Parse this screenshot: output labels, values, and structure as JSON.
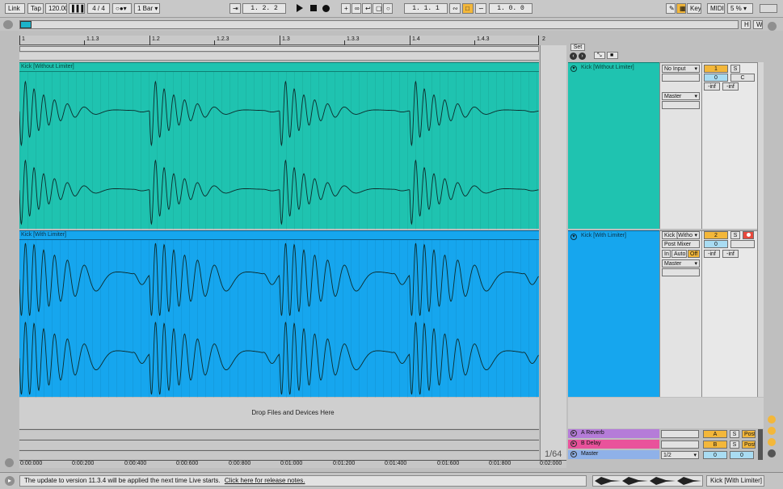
{
  "transport": {
    "link": "Link",
    "tap": "Tap",
    "tempo": "120.00",
    "signature": "4 / 4",
    "quantize": "1 Bar",
    "position": "1.  2.  2",
    "loop_start": "1.  1.  1",
    "loop_length": "1.  0.  0",
    "key": "Key",
    "midi": "MIDI",
    "cpu": "5 %",
    "h_button": "H",
    "w_button": "W"
  },
  "ruler": {
    "bars": [
      "1",
      "1.1.3",
      "1.2",
      "1.2.3",
      "1.3",
      "1.3.3",
      "1.4",
      "1.4.3",
      "2"
    ]
  },
  "tracks": [
    {
      "name": "Kick [Without Limiter]",
      "clip_label": "Kick [Without Limiter]",
      "color": "#1fc3b0",
      "input": "No Input",
      "output": "Master",
      "number": "1",
      "solo": "S",
      "volume": "0",
      "pan": "C",
      "peak_left": "-inf",
      "peak_right": "-inf"
    },
    {
      "name": "Kick [With Limiter]",
      "clip_label": "Kick [With Limiter]",
      "color": "#16a6ee",
      "input": "Kick [Witho",
      "input_channel": "Post Mixer",
      "monitor": [
        "In",
        "Auto",
        "Off"
      ],
      "output": "Master",
      "number": "2",
      "solo": "S",
      "volume": "0",
      "pan": "",
      "peak_left": "-inf",
      "peak_right": "-inf"
    }
  ],
  "drop_zone": "Drop Files and Devices Here",
  "returns": [
    {
      "name": "A Reverb",
      "letter": "A",
      "color": "#b57cd8",
      "solo": "S",
      "post": "Post"
    },
    {
      "name": "B Delay",
      "letter": "B",
      "color": "#e9529b",
      "solo": "S",
      "post": "Post"
    }
  ],
  "master": {
    "name": "Master",
    "output": "1/2",
    "volume": "0",
    "pan": "0"
  },
  "set_label": "Set",
  "grid_fraction": "1/64",
  "timeline": [
    "0:00:000",
    "0:00:200",
    "0:00:400",
    "0:00:600",
    "0:00:800",
    "0:01:000",
    "0:01:200",
    "0:01:400",
    "0:01:600",
    "0:01:800",
    "0:02:000"
  ],
  "status": {
    "message": "The update to version 11.3.4 will be applied the next time Live starts.",
    "link": "Click here for release notes.",
    "selected_track": "Kick [With Limiter]"
  }
}
